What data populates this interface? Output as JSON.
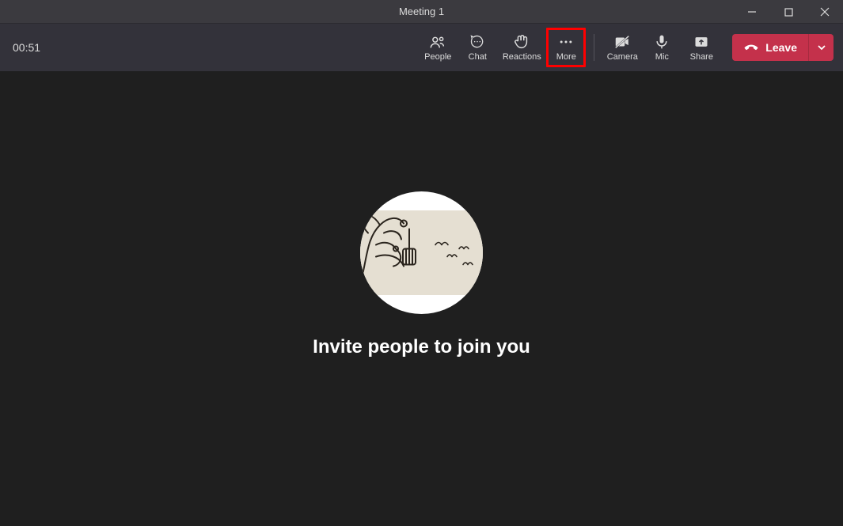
{
  "titlebar": {
    "title": "Meeting 1"
  },
  "toolbar": {
    "timer": "00:51",
    "people_label": "People",
    "chat_label": "Chat",
    "reactions_label": "Reactions",
    "more_label": "More",
    "camera_label": "Camera",
    "mic_label": "Mic",
    "share_label": "Share",
    "leave_label": "Leave",
    "highlighted": "more"
  },
  "main": {
    "invite_text": "Invite people to join you"
  }
}
